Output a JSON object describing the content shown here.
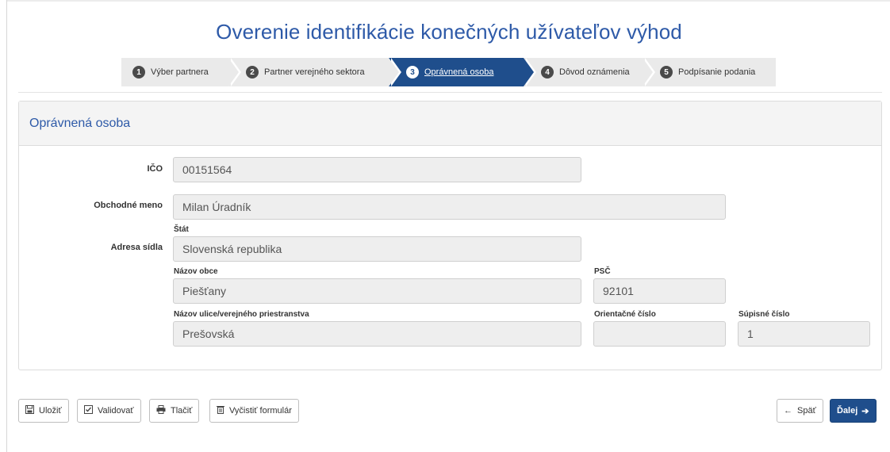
{
  "title": "Overenie identifikácie konečných užívateľov výhod",
  "wizard": {
    "steps": [
      {
        "num": "1",
        "label": "Výber partnera"
      },
      {
        "num": "2",
        "label": "Partner verejného sektora"
      },
      {
        "num": "3",
        "label": "Oprávnená osoba"
      },
      {
        "num": "4",
        "label": "Dôvod oznámenia"
      },
      {
        "num": "5",
        "label": "Podpísanie podania"
      }
    ],
    "active_step": 3
  },
  "panel": {
    "heading": "Oprávnená osoba",
    "ico": {
      "label": "IČO",
      "value": "00151564"
    },
    "obchodne_meno": {
      "label": "Obchodné meno",
      "value": "Milan Úradník"
    },
    "adresa_label": "Adresa sídla",
    "stat": {
      "label": "Štát",
      "value": "Slovenská republika"
    },
    "nazov_obce": {
      "label": "Názov obce",
      "value": "Piešťany"
    },
    "psc": {
      "label": "PSČ",
      "value": "92101"
    },
    "ulica": {
      "label": "Názov ulice/verejného priestranstva",
      "value": "Prešovská"
    },
    "orientacne_cislo": {
      "label": "Orientačné číslo",
      "value": ""
    },
    "supisne_cislo": {
      "label": "Súpisné číslo",
      "value": "1"
    }
  },
  "footer": {
    "save": "Uložiť",
    "validate": "Validovať",
    "print": "Tlačiť",
    "clear": "Vyčistiť formulár",
    "back": "Späť",
    "next": "Ďalej"
  },
  "colors": {
    "accent": "#1f4e8c",
    "title": "#2e5aa8"
  }
}
